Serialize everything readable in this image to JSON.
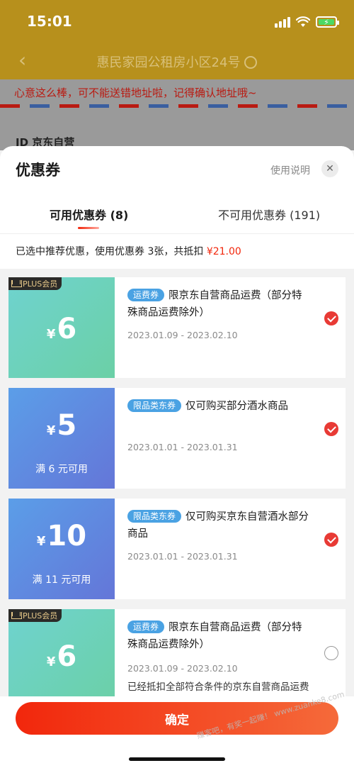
{
  "status_bar": {
    "time": "15:01"
  },
  "background": {
    "nav_title": "惠民家园公租房小区24号",
    "notice": "心意这么棒，可不能送错地址啦，记得确认地址哦~",
    "shop_name": "JD 京东自营"
  },
  "sheet": {
    "title": "优惠券",
    "usage_link": "使用说明",
    "tabs": [
      {
        "label": "可用优惠券 (8)"
      },
      {
        "label": "不可用优惠券 (191)"
      }
    ],
    "summary_prefix": "已选中推荐优惠，使用优惠券 3张，共抵扣 ",
    "summary_amount": "¥21.00",
    "plus_label": "PLUS会员",
    "currency": "¥",
    "coupons": [
      {
        "tag": "运费券",
        "desc": "限京东自营商品运费（部分特殊商品运费除外）",
        "amount": "6",
        "condition": "",
        "date": "2023.01.09 - 2023.02.10",
        "selected": true,
        "extra": ""
      },
      {
        "tag": "限品类东券",
        "desc": "仅可购买部分酒水商品",
        "amount": "5",
        "condition": "满 6 元可用",
        "date": "2023.01.01 - 2023.01.31",
        "selected": true,
        "extra": ""
      },
      {
        "tag": "限品类东券",
        "desc": "仅可购买京东自营酒水部分商品",
        "amount": "10",
        "condition": "满 11 元可用",
        "date": "2023.01.01 - 2023.01.31",
        "selected": true,
        "extra": ""
      },
      {
        "tag": "运费券",
        "desc": "限京东自营商品运费（部分特殊商品运费除外）",
        "amount": "6",
        "condition": "",
        "date": "2023.01.09 - 2023.02.10",
        "selected": false,
        "extra": "已经抵扣全部符合条件的京东自营商品运费"
      }
    ],
    "confirm_label": "确定",
    "watermark": "赚客吧，有奖一起赚！ www.zuanke8.com"
  },
  "colors": {
    "accent": "#f2270c",
    "tag_blue": "#4aa2e3",
    "header_gold": "#b7901c"
  }
}
